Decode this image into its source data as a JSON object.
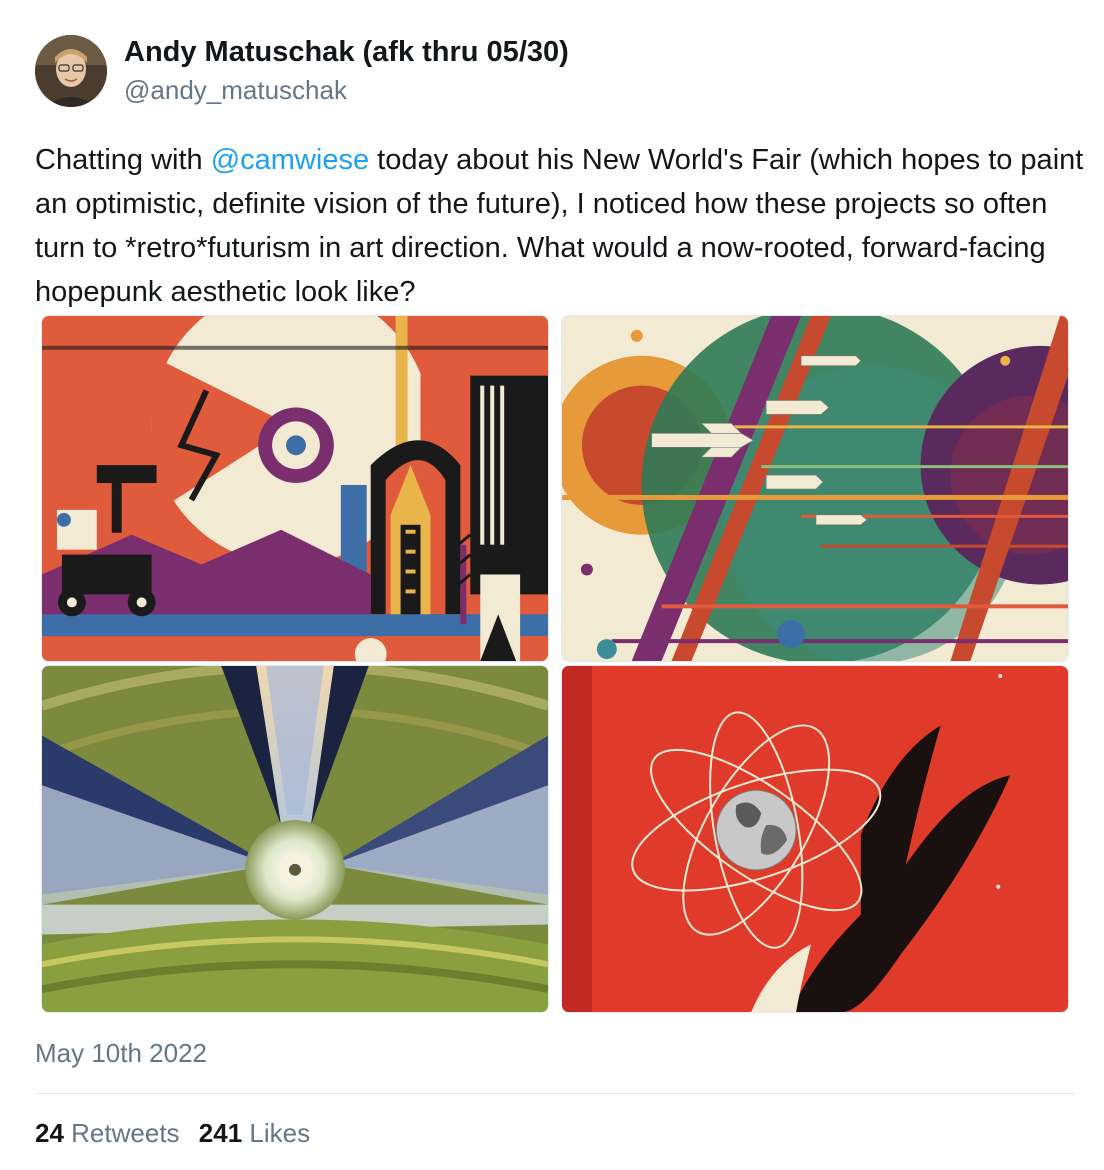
{
  "author": {
    "display_name": "Andy Matuschak (afk thru 05/30)",
    "handle": "@andy_matuschak"
  },
  "tweet": {
    "text_before_mention": "Chatting with ",
    "mention": "@camwiese",
    "text_after_mention": " today about his New World's Fair (which hopes to paint an optimistic, definite vision of the future), I noticed how these projects so often turn to *retro*futurism in art direction. What would a now-rooted, forward-facing hopepunk aesthetic look like?"
  },
  "media": [
    {
      "name": "retro-space-poster-colony"
    },
    {
      "name": "retro-space-poster-rockets"
    },
    {
      "name": "space-colony-cylinder-painting"
    },
    {
      "name": "atom-globe-red-poster"
    }
  ],
  "timestamp": "May 10th 2022",
  "stats": {
    "retweets_count": "24",
    "retweets_label": "Retweets",
    "likes_count": "241",
    "likes_label": "Likes"
  },
  "colors": {
    "mention": "#1da1f2",
    "secondary_text": "#657786",
    "primary_text": "#14171a"
  }
}
